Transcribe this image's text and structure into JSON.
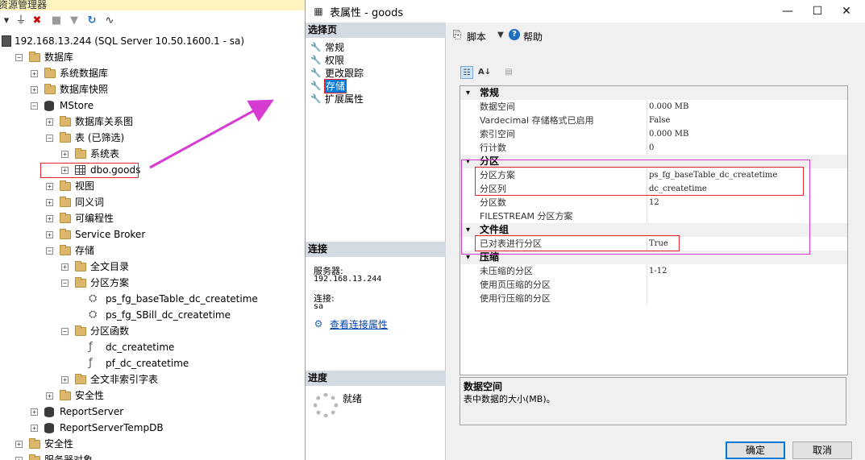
{
  "object_explorer": {
    "title": "资源管理器",
    "tree": [
      {
        "key": "server",
        "label": "192.168.13.244 (SQL Server 10.50.1600.1 - sa)",
        "icon": "server-icon",
        "expander": "",
        "indent": 0
      },
      {
        "key": "databases",
        "label": "数据库",
        "icon": "folder-icon",
        "expander": "-",
        "indent": 1
      },
      {
        "key": "system-databases",
        "label": "系统数据库",
        "icon": "folder-icon",
        "expander": "+",
        "indent": 2
      },
      {
        "key": "db-snapshots",
        "label": "数据库快照",
        "icon": "folder-icon",
        "expander": "+",
        "indent": 2
      },
      {
        "key": "mstore",
        "label": "MStore",
        "icon": "database-icon",
        "expander": "-",
        "indent": 2
      },
      {
        "key": "db-diagrams",
        "label": "数据库关系图",
        "icon": "folder-icon",
        "expander": "+",
        "indent": 3
      },
      {
        "key": "tables",
        "label": "表 (已筛选)",
        "icon": "folder-icon",
        "expander": "-",
        "indent": 3
      },
      {
        "key": "system-tables",
        "label": "系统表",
        "icon": "folder-icon",
        "expander": "+",
        "indent": 4
      },
      {
        "key": "dbo-goods",
        "label": "dbo.goods",
        "icon": "table-icon",
        "expander": "+",
        "indent": 4
      },
      {
        "key": "views",
        "label": "视图",
        "icon": "folder-icon",
        "expander": "+",
        "indent": 3
      },
      {
        "key": "synonyms",
        "label": "同义词",
        "icon": "folder-icon",
        "expander": "+",
        "indent": 3
      },
      {
        "key": "programmability",
        "label": "可编程性",
        "icon": "folder-icon",
        "expander": "+",
        "indent": 3
      },
      {
        "key": "service-broker",
        "label": "Service Broker",
        "icon": "folder-icon",
        "expander": "+",
        "indent": 3
      },
      {
        "key": "storage",
        "label": "存储",
        "icon": "folder-icon",
        "expander": "-",
        "indent": 3
      },
      {
        "key": "fulltext-catalogs",
        "label": "全文目录",
        "icon": "folder-icon",
        "expander": "+",
        "indent": 4
      },
      {
        "key": "partition-schemes",
        "label": "分区方案",
        "icon": "folder-icon",
        "expander": "-",
        "indent": 4
      },
      {
        "key": "ps-basetable",
        "label": "ps_fg_baseTable_dc_createtime",
        "icon": "partition-scheme-icon",
        "expander": "",
        "indent": 5
      },
      {
        "key": "ps-sbill",
        "label": "ps_fg_SBill_dc_createtime",
        "icon": "partition-scheme-icon",
        "expander": "",
        "indent": 5
      },
      {
        "key": "partition-functions",
        "label": "分区函数",
        "icon": "folder-icon",
        "expander": "-",
        "indent": 4
      },
      {
        "key": "dc-createtime",
        "label": "dc_createtime",
        "icon": "partition-function-icon",
        "expander": "",
        "indent": 5
      },
      {
        "key": "pf-dc-createtime",
        "label": "pf_dc_createtime",
        "icon": "partition-function-icon",
        "expander": "",
        "indent": 5
      },
      {
        "key": "fulltext-stoplists",
        "label": "全文非索引字表",
        "icon": "folder-icon",
        "expander": "+",
        "indent": 4
      },
      {
        "key": "security-db",
        "label": "安全性",
        "icon": "folder-icon",
        "expander": "+",
        "indent": 3
      },
      {
        "key": "reportserver",
        "label": "ReportServer",
        "icon": "database-icon",
        "expander": "+",
        "indent": 2
      },
      {
        "key": "reportservertempdb",
        "label": "ReportServerTempDB",
        "icon": "database-icon",
        "expander": "+",
        "indent": 2
      },
      {
        "key": "security",
        "label": "安全性",
        "icon": "folder-icon",
        "expander": "+",
        "indent": 1
      },
      {
        "key": "server-objects",
        "label": "服务器对象",
        "icon": "folder-icon",
        "expander": "+",
        "indent": 1
      }
    ]
  },
  "dialog": {
    "title": "表属性 - goods",
    "select_page_header": "选择页",
    "pages": [
      {
        "label": "常规",
        "selected": false
      },
      {
        "label": "权限",
        "selected": false
      },
      {
        "label": "更改跟踪",
        "selected": false
      },
      {
        "label": "存储",
        "selected": true
      },
      {
        "label": "扩展属性",
        "selected": false
      }
    ],
    "toolbar": {
      "script_label": "脚本",
      "help_label": "帮助"
    },
    "connection": {
      "header": "连接",
      "server_label": "服务器:",
      "server_value": "192.168.13.244",
      "conn_label": "连接:",
      "conn_value": "sa",
      "view_link": "查看连接属性"
    },
    "progress": {
      "header": "进度",
      "status": "就绪"
    },
    "grid": [
      {
        "type": "category",
        "name": "常规"
      },
      {
        "type": "prop",
        "name": "数据空间",
        "value": "0.000 MB"
      },
      {
        "type": "prop",
        "name": "Vardecimal 存储格式已启用",
        "value": "False"
      },
      {
        "type": "prop",
        "name": "索引空间",
        "value": "0.000 MB"
      },
      {
        "type": "prop",
        "name": "行计数",
        "value": "0"
      },
      {
        "type": "category",
        "name": "分区"
      },
      {
        "type": "prop",
        "name": "分区方案",
        "value": "ps_fg_baseTable_dc_createtime"
      },
      {
        "type": "prop",
        "name": "分区列",
        "value": "dc_createtime"
      },
      {
        "type": "prop",
        "name": "分区数",
        "value": "12"
      },
      {
        "type": "prop",
        "name": "FILESTREAM 分区方案",
        "value": ""
      },
      {
        "type": "category",
        "name": "文件组"
      },
      {
        "type": "prop",
        "name": "已对表进行分区",
        "value": "True"
      },
      {
        "type": "category",
        "name": "压缩"
      },
      {
        "type": "prop",
        "name": "未压缩的分区",
        "value": "1-12"
      },
      {
        "type": "prop",
        "name": "使用页压缩的分区",
        "value": ""
      },
      {
        "type": "prop",
        "name": "使用行压缩的分区",
        "value": ""
      }
    ],
    "description": {
      "title": "数据空间",
      "text": "表中数据的大小(MB)。"
    },
    "buttons": {
      "ok": "确定",
      "cancel": "取消"
    },
    "window_controls": {
      "minimize": "—",
      "maximize": "☐",
      "close": "✕"
    }
  },
  "colors": {
    "annotation_red": "#e8232c",
    "annotation_magenta": "#d63bd2",
    "selection": "#0078d7"
  }
}
